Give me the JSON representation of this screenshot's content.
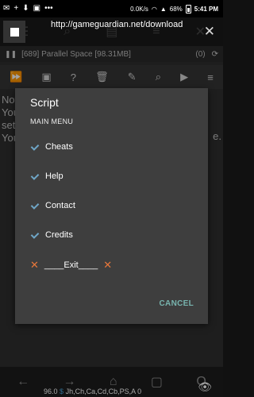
{
  "status_bar": {
    "net_speed": "0.0K/s",
    "battery_percent": "68%",
    "time": "5:41 PM"
  },
  "overlay": {
    "url": "http://gameguardian.net/download"
  },
  "process": {
    "label": "[689] Parallel Space [98.31MB]",
    "count": "(0)"
  },
  "background_text": {
    "lines": [
      "Not",
      "You",
      "sett",
      "You"
    ],
    "right_fragment": "e."
  },
  "dialog": {
    "title": "Script",
    "header": "MAIN MENU",
    "items": [
      {
        "label": "Cheats",
        "checked": true
      },
      {
        "label": "Help",
        "checked": true
      },
      {
        "label": "Contact",
        "checked": true
      },
      {
        "label": "Credits",
        "checked": true
      }
    ],
    "exit_label": "____Exit____",
    "cancel_label": "CANCEL"
  },
  "bottom": {
    "status_text_prefix": "96.0",
    "status_dollar": "$",
    "status_text": "Jh,Ch,Ca,Cd,Cb,PS,A 0"
  },
  "colors": {
    "check": "#6fa6c7",
    "exit_x": "#e8773a",
    "cancel": "#78b4ae"
  }
}
